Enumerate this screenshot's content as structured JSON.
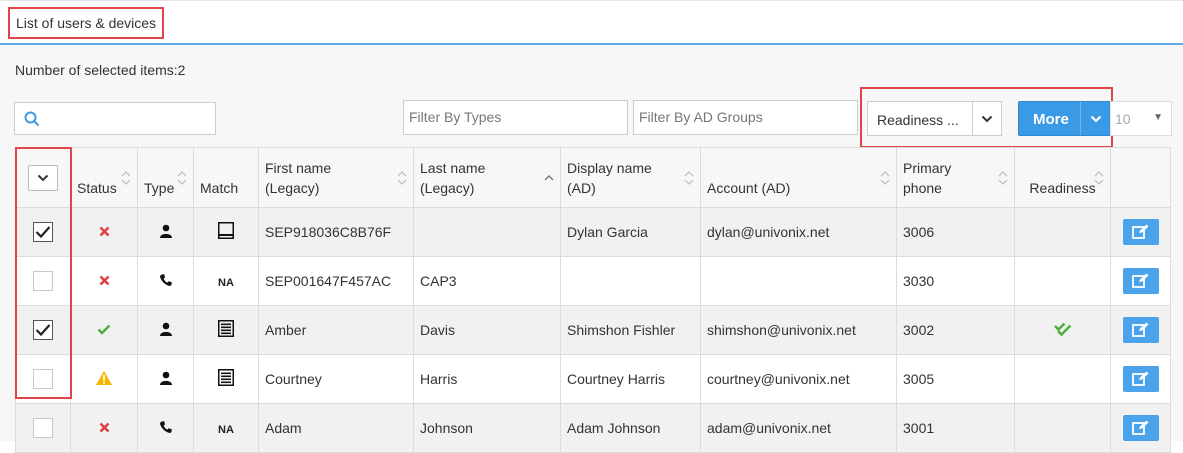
{
  "header": {
    "title": "List of users & devices"
  },
  "toolbar": {
    "selected_count_text": "Number of selected items:2",
    "search_placeholder": "",
    "filter_types_placeholder": "Filter By Types",
    "filter_ad_groups_placeholder": "Filter By AD Groups",
    "readiness_select_value": "Readiness ...",
    "more_label": "More",
    "page_size_value": "10"
  },
  "table": {
    "headers": {
      "status": "Status",
      "type": "Type",
      "match": "Match",
      "first_name": "First name (Legacy)",
      "last_name": "Last name (Legacy)",
      "display_name": "Display name (AD)",
      "account": "Account (AD)",
      "primary_phone": "Primary phone",
      "readiness": "Readiness"
    },
    "rows": [
      {
        "checked": true,
        "status": "error",
        "type": "user",
        "match": "partial",
        "first_name": "SEP918036C8B76F",
        "last_name": "",
        "display_name": "Dylan Garcia",
        "account": "dylan@univonix.net",
        "primary_phone": "3006",
        "readiness": ""
      },
      {
        "checked": false,
        "status": "error",
        "type": "phone",
        "match": "NA",
        "first_name": "SEP001647F457AC",
        "last_name": "CAP3",
        "display_name": "",
        "account": "",
        "primary_phone": "3030",
        "readiness": ""
      },
      {
        "checked": true,
        "status": "ok",
        "type": "user",
        "match": "full",
        "first_name": "Amber",
        "last_name": "Davis",
        "display_name": "Shimshon Fishler",
        "account": "shimshon@univonix.net",
        "primary_phone": "3002",
        "readiness": "ready"
      },
      {
        "checked": false,
        "status": "warning",
        "type": "user",
        "match": "full",
        "first_name": "Courtney",
        "last_name": "Harris",
        "display_name": "Courtney Harris",
        "account": "courtney@univonix.net",
        "primary_phone": "3005",
        "readiness": ""
      },
      {
        "checked": false,
        "status": "error",
        "type": "phone",
        "match": "NA",
        "first_name": "Adam",
        "last_name": "Johnson",
        "display_name": "Adam Johnson",
        "account": "adam@univonix.net",
        "primary_phone": "3001",
        "readiness": ""
      }
    ]
  },
  "colors": {
    "accent": "#3b9ae6",
    "error": "#e23b3b",
    "ok": "#4caf3a",
    "warning": "#f5b800",
    "highlight_frame": "#e0454a"
  }
}
